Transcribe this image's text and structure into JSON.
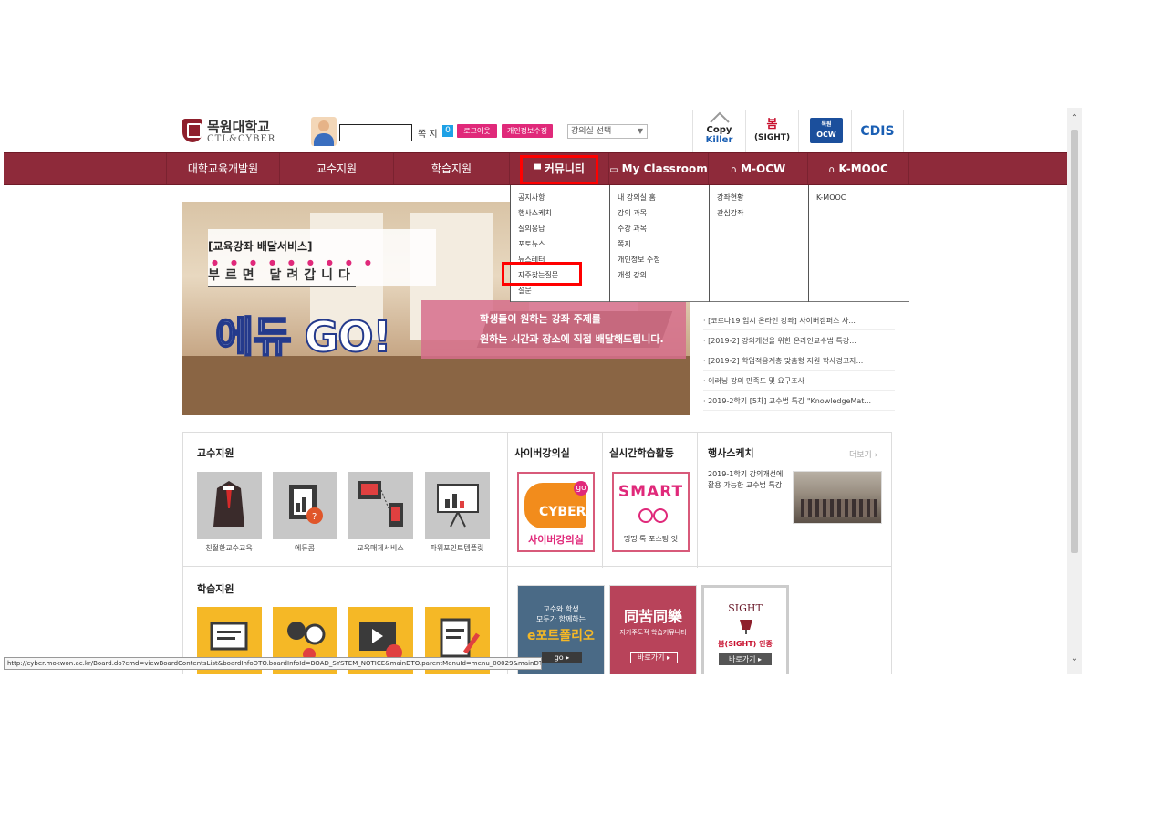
{
  "header": {
    "logo_ko": "목원대학교",
    "logo_en": "CTL&CYBER",
    "message_label": "쪽 지",
    "message_count": "0",
    "logout_label": "로그아웃",
    "profile_edit_label": "개인정보수정",
    "classroom_select_value": "강의실 선택",
    "quicklinks": {
      "copykiller_1": "Copy",
      "copykiller_2": "Killer",
      "sight_1": "봄",
      "sight_2": "(SIGHT)",
      "ocw_1": "목원",
      "ocw_2": "OCW",
      "cdis": "CDIS"
    }
  },
  "nav": {
    "items": [
      {
        "label": "대학교육개발원"
      },
      {
        "label": "교수지원"
      },
      {
        "label": "학습지원"
      },
      {
        "label": "커뮤니티"
      },
      {
        "label": "My Classroom"
      },
      {
        "label": "M-OCW"
      },
      {
        "label": "K-MOOC"
      }
    ]
  },
  "dropdown": {
    "community": [
      "공지사항",
      "행사스케치",
      "질의응답",
      "포토뉴스",
      "뉴스레터",
      "자주찾는질문",
      "설문"
    ],
    "myclassroom": [
      "내 강의실 홈",
      "강의 과목",
      "수강 과목",
      "쪽지",
      "개인정보 수정",
      "개설 강의"
    ],
    "mocw": [
      "강좌현황",
      "관심강좌"
    ],
    "kmooc": [
      "K-MOOC"
    ]
  },
  "banner": {
    "tag": "[교육강좌 배달서비스]",
    "tagline": "부르면 달려갑니다",
    "title": "에듀 GO!",
    "sub1": "학생들이 원하는 강좌 주제를",
    "sub2": "원하는 시간과 장소에 직접 배달해드립니다."
  },
  "notices": [
    "[코로나19 임시 온라인 강좌] 사이버캠퍼스 사...",
    "[2019-2] 강의개선을 위한 온라인교수법 특강...",
    "[2019-2] 학업적응계층 맞춤형 지원 학사경고자...",
    "이러닝 강의 만족도 및 요구조사",
    "2019-2학기 [5차] 교수법 특강 \"KnowledgeMat..."
  ],
  "faculty": {
    "title": "교수지원",
    "tiles": [
      {
        "caption": "친절한교수교육"
      },
      {
        "caption": "에듀콤"
      },
      {
        "caption": "교육매체서비스"
      },
      {
        "caption": "파워포인트템플릿"
      }
    ]
  },
  "cyber": {
    "title": "사이버강의실",
    "card_text": "사이버강의실",
    "card_logo": "CYBER",
    "card_badge": "go"
  },
  "realtime": {
    "title": "실시간학습활동",
    "card_text": "SMART",
    "card_sub": "띵띵 톡 포스팅 잇"
  },
  "sketch": {
    "title": "행사스케치",
    "more": "더보기",
    "text": "2019-1학기 강의개선에 활용 가능한 교수법 특강"
  },
  "learning": {
    "title": "학습지원"
  },
  "promo": {
    "portfolio_1": "교수와 학생",
    "portfolio_2": "모두가 함께하는",
    "portfolio_3": "e포트폴리오",
    "portfolio_btn": "go",
    "dongo_title": "同苦同樂",
    "dongo_sub": "자기주도적 학습커뮤니티",
    "dongo_btn": "바로가기",
    "sight_title": "SIGHT",
    "sight_sub": "봄(SIGHT) 인증",
    "sight_btn": "바로가기"
  },
  "statusbar": {
    "url": "http://cyber.mokwon.ac.kr/Board.do?cmd=viewBoardContentsList&boardInfoDTO.boardInfoId=BOAD_SYSTEM_NOTICE&mainDTO.parentMenuId=menu_00029&mainDTO.m..."
  },
  "colors": {
    "brand": "#8e2a3a",
    "accent_pink": "#e0297a",
    "highlight": "#ff0000"
  }
}
